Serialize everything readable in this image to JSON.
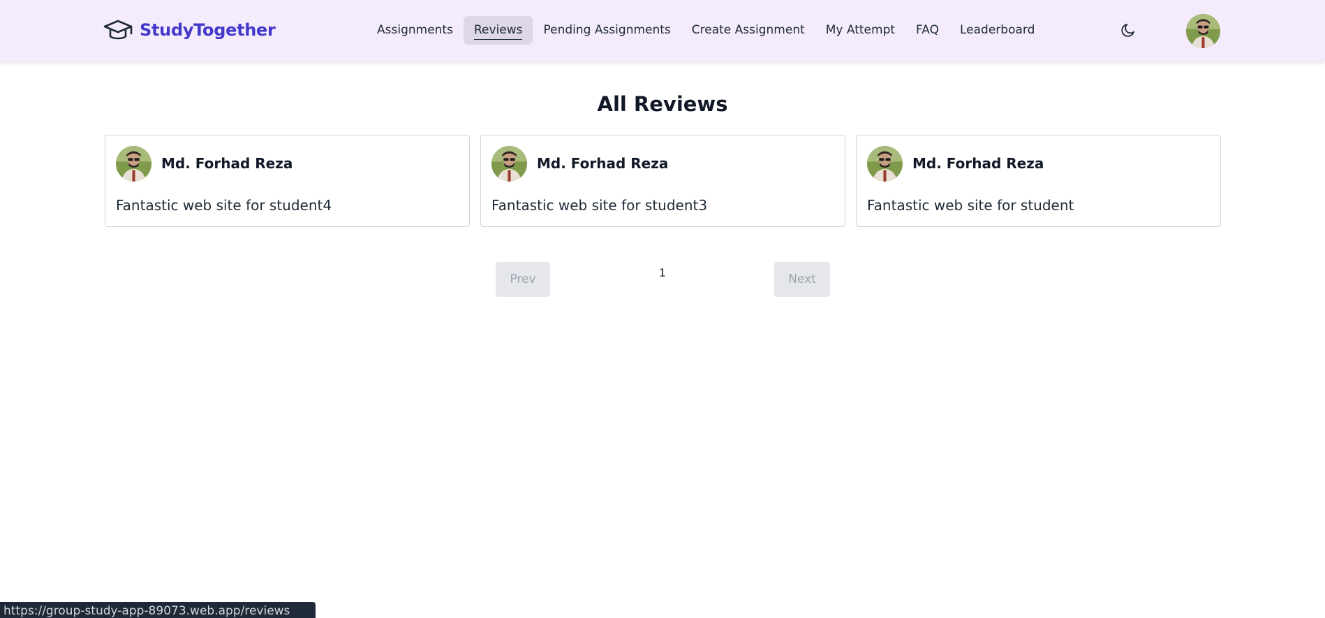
{
  "header": {
    "brand": "StudyTogether",
    "brand_icon": "graduation-cap-icon",
    "brand_color": "#4338ca",
    "background": "#f4ecfd",
    "nav": [
      {
        "label": "Assignments",
        "active": false
      },
      {
        "label": "Reviews",
        "active": true
      },
      {
        "label": "Pending Assignments",
        "active": false
      },
      {
        "label": "Create Assignment",
        "active": false
      },
      {
        "label": "My Attempt",
        "active": false
      },
      {
        "label": "FAQ",
        "active": false
      },
      {
        "label": "Leaderboard",
        "active": false
      }
    ],
    "theme_toggle_icon": "moon-icon",
    "avatar_icon": "user-avatar"
  },
  "main": {
    "title": "All Reviews",
    "reviews": [
      {
        "name": "Md. Forhad Reza",
        "text": "Fantastic web site for student4"
      },
      {
        "name": "Md. Forhad Reza",
        "text": "Fantastic web site for student3"
      },
      {
        "name": "Md. Forhad Reza",
        "text": "Fantastic web site for student"
      }
    ]
  },
  "pagination": {
    "prev": "Prev",
    "current_page": "1",
    "next": "Next"
  },
  "status_bar": {
    "url": "https://group-study-app-89073.web.app/reviews"
  }
}
